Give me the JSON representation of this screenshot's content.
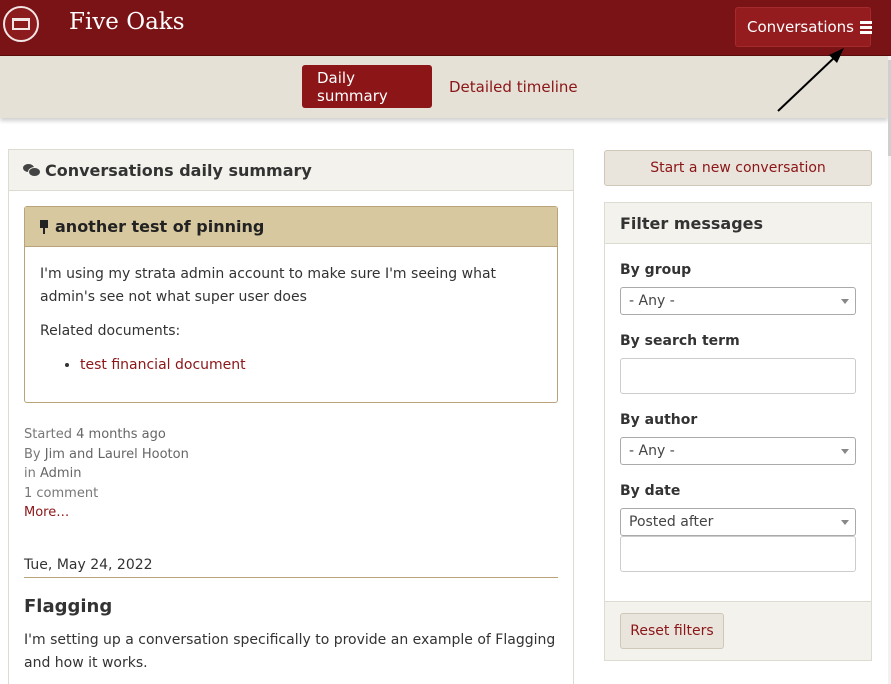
{
  "header": {
    "brand": "Five Oaks",
    "conversations_button": "Conversations"
  },
  "subnav": {
    "tabs": [
      {
        "label": "Daily summary",
        "active": true
      },
      {
        "label": "Detailed timeline",
        "active": false
      }
    ]
  },
  "main": {
    "panel_title": "Conversations daily summary",
    "pinned": {
      "title": "another test of pinning",
      "body": "I'm using my strata admin account to make sure I'm seeing what admin's see not what super user does",
      "related_label": "Related documents:",
      "documents": [
        "test financial document"
      ]
    },
    "meta": {
      "started_prefix": "Started",
      "started_value": "4 months ago",
      "by_prefix": "By",
      "by_value": "Jim and Laurel Hooton",
      "in_prefix": "in",
      "in_value": "Admin",
      "comments": "1 comment",
      "more": "More…"
    },
    "date_heading": "Tue, May 24, 2022",
    "conversation": {
      "title": "Flagging",
      "body": "I'm setting up a conversation specifically to provide an example of Flagging and how it works."
    }
  },
  "sidebar": {
    "start_button": "Start a new conversation",
    "filter_title": "Filter messages",
    "group_label": "By group",
    "group_value": "- Any -",
    "search_label": "By search term",
    "search_value": "",
    "author_label": "By author",
    "author_value": "- Any -",
    "date_label": "By date",
    "date_value": "Posted after",
    "date_input_value": "",
    "reset_button": "Reset filters"
  },
  "colors": {
    "brand_red": "#7a1315",
    "accent_red": "#8b1517",
    "tan": "#d7c8a0",
    "subnav_bg": "#e5e1d6"
  },
  "icons": {
    "logo": "bench-logo",
    "menu": "bars-icon",
    "chat": "comments-icon",
    "pin": "thumbtack-icon"
  }
}
